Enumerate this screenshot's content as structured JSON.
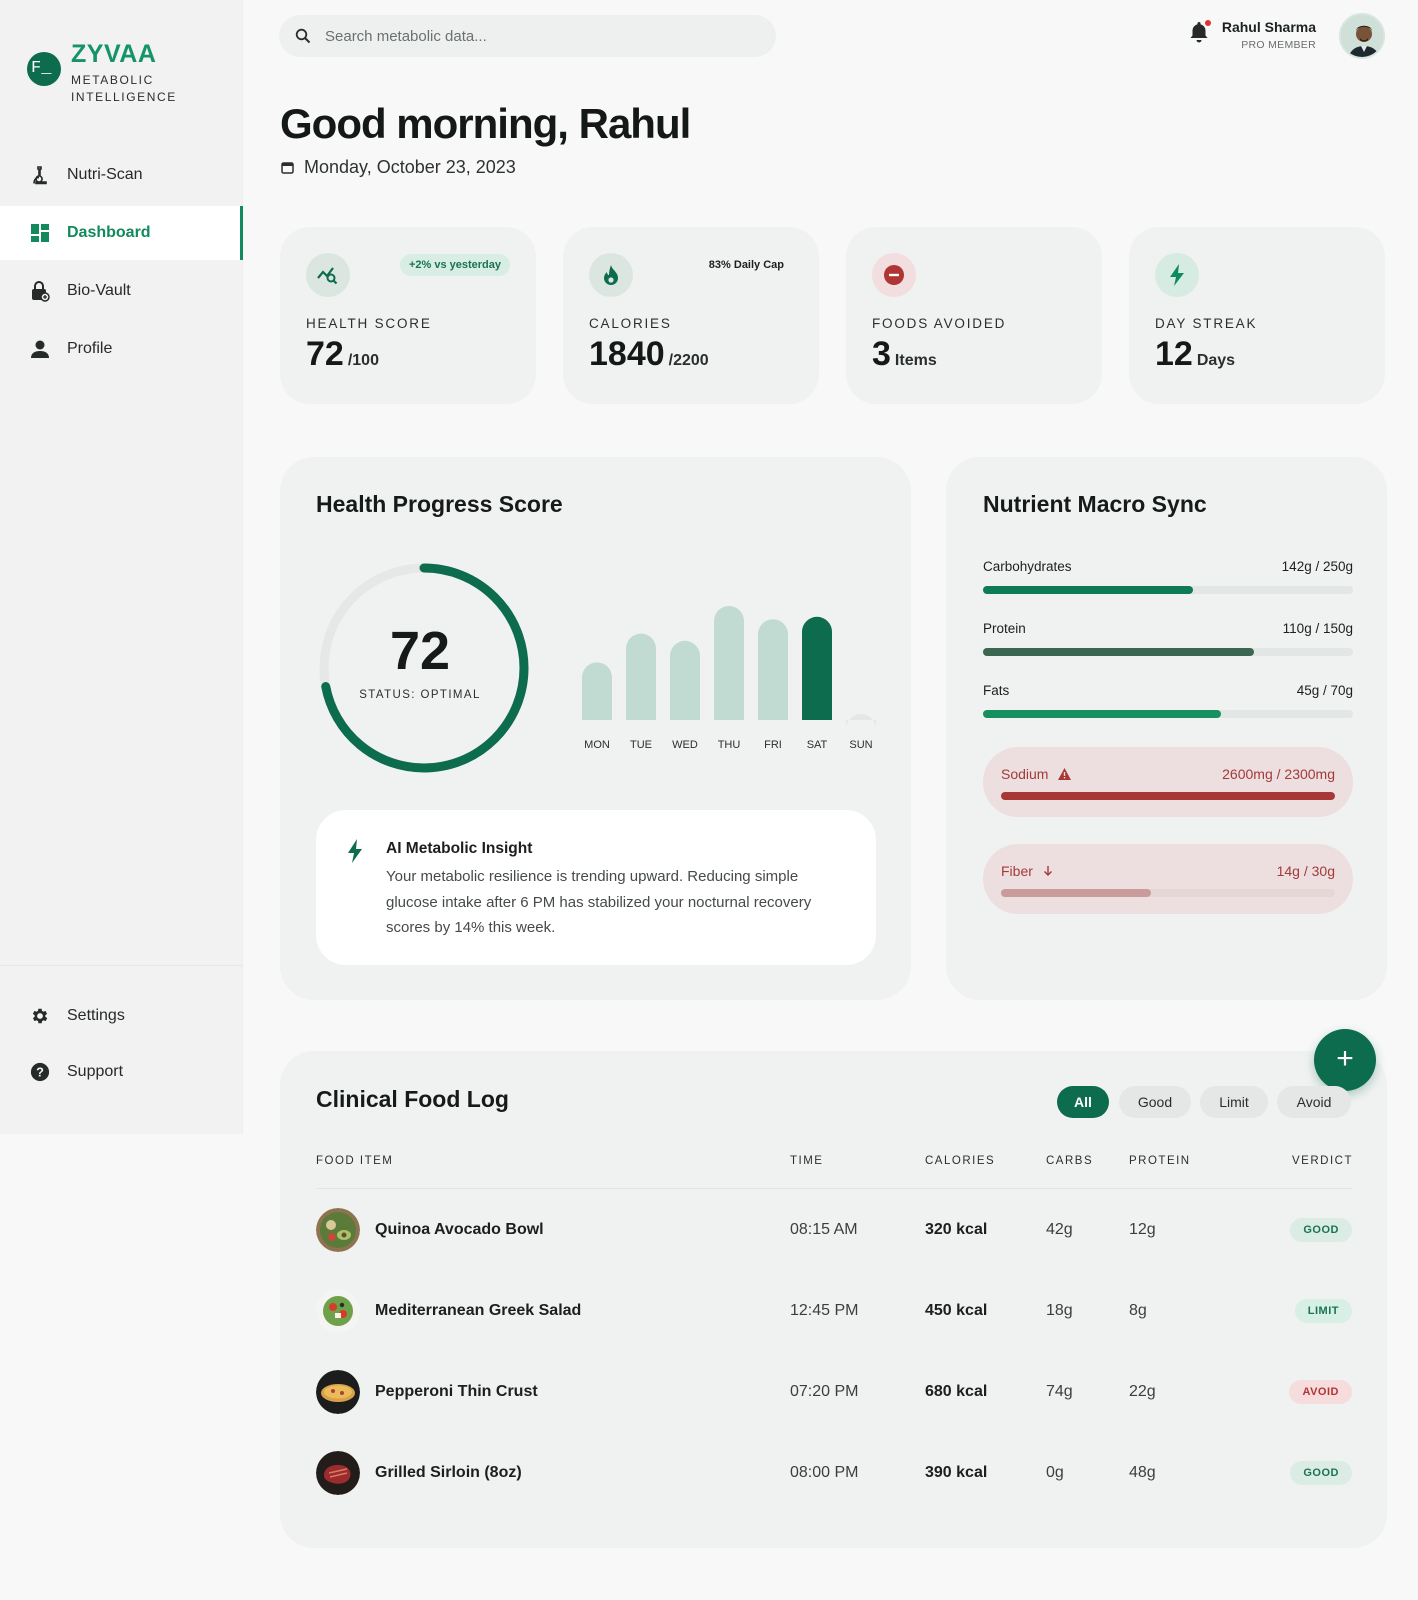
{
  "brand": {
    "name": "ZYVAA",
    "tagline": "METABOLIC INTELLIGENCE",
    "mark": "F_"
  },
  "nav": {
    "items": [
      {
        "label": "Nutri-Scan",
        "icon": "microscope-icon"
      },
      {
        "label": "Dashboard",
        "icon": "dashboard-icon",
        "active": true
      },
      {
        "label": "Bio-Vault",
        "icon": "vault-icon"
      },
      {
        "label": "Profile",
        "icon": "person-icon"
      }
    ],
    "bottom": [
      {
        "label": "Settings",
        "icon": "gear-icon"
      },
      {
        "label": "Support",
        "icon": "help-icon"
      }
    ]
  },
  "search": {
    "placeholder": "Search metabolic data..."
  },
  "user": {
    "name": "Rahul Sharma",
    "role": "PRO MEMBER"
  },
  "greeting": {
    "title": "Good morning, Rahul",
    "date": "Monday, October 23, 2023"
  },
  "stats": [
    {
      "label": "HEALTH SCORE",
      "value": "72",
      "unit": "/100",
      "badge": "+2% vs yesterday",
      "icon": "health-chart-icon"
    },
    {
      "label": "CALORIES",
      "value": "1840",
      "unit": "/2200",
      "badge": "83% Daily Cap",
      "icon": "flame-icon"
    },
    {
      "label": "FOODS AVOIDED",
      "value": "3",
      "unit": "Items",
      "icon": "minus-circle-icon"
    },
    {
      "label": "DAY STREAK",
      "value": "12",
      "unit": "Days",
      "icon": "bolt-icon"
    }
  ],
  "progress": {
    "title": "Health Progress Score",
    "score": "72",
    "status": "STATUS: OPTIMAL",
    "score_fraction": 0.72,
    "chart_data": {
      "type": "bar",
      "categories": [
        "MON",
        "TUE",
        "WED",
        "THU",
        "FRI",
        "SAT",
        "SUN"
      ],
      "values": [
        48,
        72,
        66,
        95,
        84,
        86,
        4
      ],
      "highlight": "SAT"
    },
    "insight": {
      "title": "AI Metabolic Insight",
      "body": "Your metabolic resilience is trending upward. Reducing simple glucose intake after 6 PM has stabilized your nocturnal recovery scores by 14% this week."
    }
  },
  "macros": {
    "title": "Nutrient Macro Sync",
    "items": [
      {
        "name": "Carbohydrates",
        "value": "142g / 250g",
        "fraction": 0.568,
        "color": "#0f7a56"
      },
      {
        "name": "Protein",
        "value": "110g / 150g",
        "fraction": 0.733,
        "color": "#3a6652"
      },
      {
        "name": "Fats",
        "value": "45g / 70g",
        "fraction": 0.643,
        "color": "#17905f"
      }
    ],
    "alerts": [
      {
        "name": "Sodium",
        "value": "2600mg / 2300mg",
        "fraction": 1.0,
        "color": "#a83838",
        "icon": "warning-icon"
      },
      {
        "name": "Fiber",
        "value": "14g / 30g",
        "fraction": 0.45,
        "color": "#c99b9b",
        "icon": "arrow-down-icon"
      }
    ]
  },
  "food_log": {
    "title": "Clinical Food Log",
    "filters": [
      "All",
      "Good",
      "Limit",
      "Avoid"
    ],
    "active_filter": "All",
    "columns": [
      "FOOD ITEM",
      "TIME",
      "CALORIES",
      "CARBS",
      "PROTEIN",
      "VERDICT"
    ],
    "rows": [
      {
        "food": "Quinoa Avocado Bowl",
        "time": "08:15 AM",
        "calories": "320 kcal",
        "carbs": "42g",
        "protein": "12g",
        "verdict": "GOOD",
        "image": "quinoa-bowl-image"
      },
      {
        "food": "Mediterranean Greek Salad",
        "time": "12:45 PM",
        "calories": "450 kcal",
        "carbs": "18g",
        "protein": "8g",
        "verdict": "LIMIT",
        "image": "greek-salad-image"
      },
      {
        "food": "Pepperoni Thin Crust",
        "time": "07:20 PM",
        "calories": "680 kcal",
        "carbs": "74g",
        "protein": "22g",
        "verdict": "AVOID",
        "image": "pizza-image"
      },
      {
        "food": "Grilled Sirloin (8oz)",
        "time": "08:00 PM",
        "calories": "390 kcal",
        "carbs": "0g",
        "protein": "48g",
        "verdict": "GOOD",
        "image": "steak-image"
      }
    ]
  },
  "colors": {
    "brand": "#0d6b4e",
    "accent": "#159467",
    "bar_light": "#c2dbd2",
    "alert": "#a83838"
  }
}
